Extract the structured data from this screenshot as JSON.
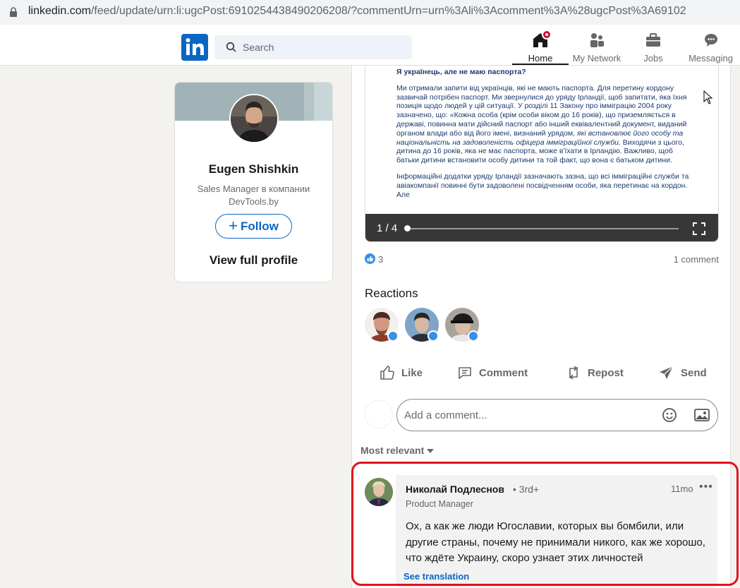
{
  "browser": {
    "url_host": "linkedin.com",
    "url_rest": "/feed/update/urn:li:ugcPost:6910254438490206208/?commentUrn=urn%3Ali%3Acomment%3A%28ugcPost%3A69102"
  },
  "nav": {
    "search_placeholder": "Search",
    "items": [
      {
        "label": "Home",
        "icon": "home-icon"
      },
      {
        "label": "My Network",
        "icon": "network-icon"
      },
      {
        "label": "Jobs",
        "icon": "briefcase-icon"
      },
      {
        "label": "Messaging",
        "icon": "messaging-icon"
      }
    ]
  },
  "profile": {
    "name": "Eugen Shishkin",
    "headline_line1": "Sales Manager в компании",
    "headline_line2": "DevTools.by",
    "follow_label": "Follow",
    "view_profile_label": "View full profile"
  },
  "document": {
    "heading": "Я українець, але не маю паспорта?",
    "para1": "Ми отримали запити від українців, які не мають паспорта. Для перетину кордону зазвичай потрібен паспорт. Ми звернулися до уряду Ірландії, щоб запитати, яка їхня позиція щодо людей у цій ситуації. У розділі 11 Закону про імміграцію 2004 року зазначено, що: «Кожна особа (крім особи віком до 16 років), що приземляється в державі, повинна мати дійсний паспорт або інший еквівалентний документ, виданий органом влади або від його імені, визнаний урядом,",
    "para1_italic": " які встановлює його особу та національність на задоволеність офіцера імміграційної служби.",
    "para1_end": " Виходячи з цього, дитина до 16 років, яка не має паспорта, може в'їхати в Ірландію. Важливо, щоб батьки дитини встановити особу дитини та той факт, що вона є батьком дитини.",
    "para2": "Інформаційні додатки уряду Ірландії зазначають зазна, що всі імміграційні служби та авіакомпанії повинні бути задоволені посвідченням особи, яка перетинає на кордон. Але",
    "page_counter": "1 / 4"
  },
  "social": {
    "reaction_count": "3",
    "comment_count": "1 comment"
  },
  "reactions": {
    "title": "Reactions"
  },
  "actions": {
    "like": "Like",
    "comment": "Comment",
    "repost": "Repost",
    "send": "Send"
  },
  "comment_box": {
    "placeholder": "Add a comment..."
  },
  "sort": {
    "label": "Most relevant"
  },
  "comment": {
    "author": "Николай Подлеснов",
    "degree": "• 3rd+",
    "time": "11mo",
    "more": "•••",
    "title": "Product Manager",
    "text": "Ох, а как же люди Югославии, которых вы бомбили, или другие страны, почему не принимали никого, как же хорошо, что ждёте Украину, скоро узнает этих личностей",
    "translate": "See translation"
  },
  "colors": {
    "brand": "#0a66c2",
    "highlight": "#e2121b",
    "notification": "#cb112d"
  }
}
